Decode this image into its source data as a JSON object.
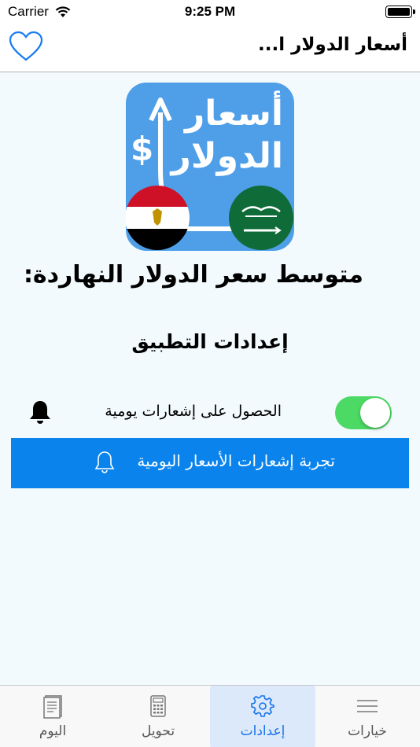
{
  "status_bar": {
    "carrier": "Carrier",
    "time": "9:25 PM"
  },
  "nav": {
    "title": "أسعار الدولار ا..."
  },
  "logo": {
    "text_line1": "أسعار",
    "text_line2": "الدولار",
    "currency_symbol": "$",
    "left_flag": "egypt-flag",
    "right_flag": "saudi-flag"
  },
  "main": {
    "avg_price_title": "متوسط سعر الدولار النهاردة:",
    "settings_title": "إعدادات التطبيق",
    "notifications": {
      "label": "الحصول على إشعارات يومية",
      "enabled": true
    },
    "test_button_label": "تجربة إشعارات الأسعار اليومية"
  },
  "tab_bar": {
    "tabs": [
      {
        "label": "اليوم",
        "icon": "document-icon",
        "active": false
      },
      {
        "label": "تحويل",
        "icon": "calculator-icon",
        "active": false
      },
      {
        "label": "إعدادات",
        "icon": "gear-icon",
        "active": true
      },
      {
        "label": "خيارات",
        "icon": "menu-icon",
        "active": false
      }
    ]
  },
  "colors": {
    "accent": "#0a84ec",
    "toggle_on": "#4cd964",
    "background": "#f3fafd",
    "logo_bg": "#4f9ee8",
    "active_tab_bg": "#dbe9fb"
  }
}
